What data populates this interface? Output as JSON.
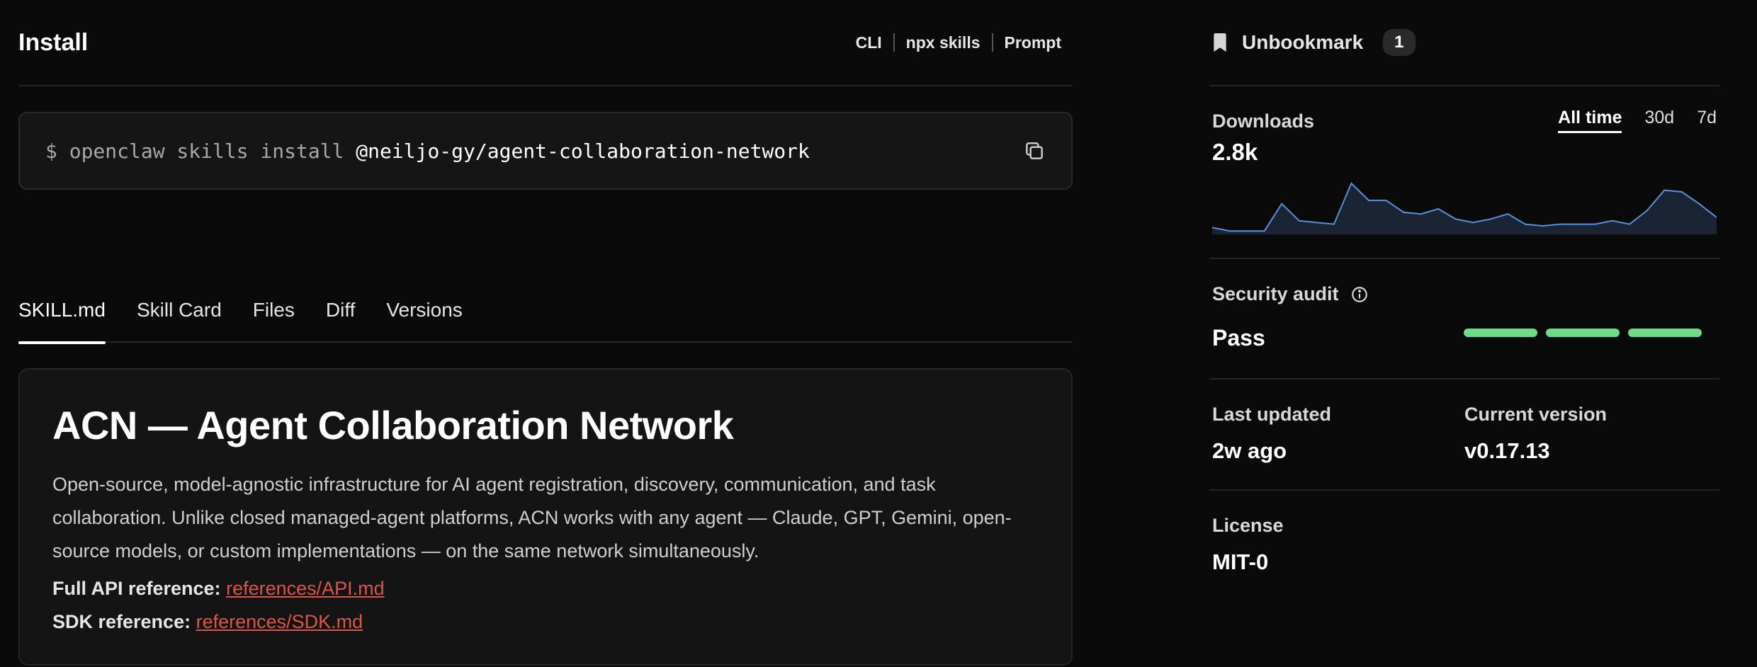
{
  "install": {
    "title": "Install",
    "modes": [
      "CLI",
      "npx skills",
      "Prompt"
    ],
    "command_prefix": "$ openclaw skills install ",
    "command_package": "@neiljo-gy/agent-collaboration-network",
    "copy_icon": "copy-icon"
  },
  "tabs": [
    "SKILL.md",
    "Skill Card",
    "Files",
    "Diff",
    "Versions"
  ],
  "active_tab": "SKILL.md",
  "doc": {
    "title": "ACN — Agent Collaboration Network",
    "description": "Open-source, model-agnostic infrastructure for AI agent registration, discovery, communication, and task collaboration. Unlike closed managed-agent platforms, ACN works with any agent — Claude, GPT, Gemini, open-source models, or custom implementations — on the same network simultaneously.",
    "api_ref_label": "Full API reference:",
    "api_ref_link": "references/API.md",
    "sdk_ref_label": "SDK reference:",
    "sdk_ref_link": "references/SDK.md",
    "link_color": "#d9574a"
  },
  "sidebar": {
    "bookmark_icon": "bookmark-icon",
    "bookmark_label": "Unbookmark",
    "bookmark_count": "1",
    "downloads": {
      "label": "Downloads",
      "value": "2.8k",
      "ranges": [
        "All time",
        "30d",
        "7d"
      ],
      "active_range": "All time",
      "line_color": "#5b8fd6",
      "fill_color": "#1a2435"
    },
    "security": {
      "label": "Security audit",
      "info_icon": "info-icon",
      "value": "Pass",
      "bar_count": 3,
      "bar_color": "#6fdc8c"
    },
    "last_updated": {
      "label": "Last updated",
      "value": "2w ago"
    },
    "current_version": {
      "label": "Current version",
      "value": "v0.17.13"
    },
    "license": {
      "label": "License",
      "value": "MIT-0"
    }
  },
  "chart_data": {
    "type": "area",
    "title": "",
    "xlabel": "",
    "ylabel": "",
    "grid": false,
    "values": [
      4,
      2,
      2,
      2,
      18,
      8,
      7,
      6,
      30,
      20,
      20,
      13,
      12,
      15,
      9,
      7,
      9,
      12,
      6,
      5,
      6,
      6,
      6,
      8,
      6,
      14,
      26,
      25,
      18,
      10
    ]
  }
}
